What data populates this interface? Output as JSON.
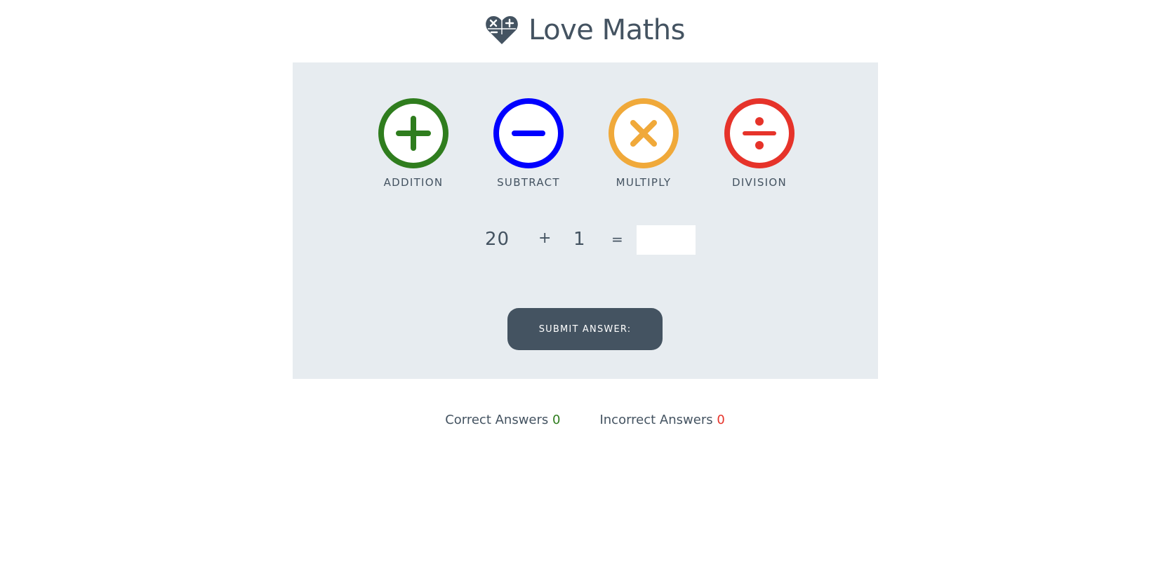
{
  "header": {
    "title": "Love Maths",
    "logo_icon": "heart-calculator-icon"
  },
  "operations": [
    {
      "label": "ADDITION",
      "icon": "plus-circle-icon",
      "color": "#2f7d1e"
    },
    {
      "label": "SUBTRACT",
      "icon": "minus-circle-icon",
      "color": "#0000ff"
    },
    {
      "label": "MULTIPLY",
      "icon": "times-circle-icon",
      "color": "#f0a93a"
    },
    {
      "label": "DIVISION",
      "icon": "divide-circle-icon",
      "color": "#e6332a"
    }
  ],
  "question": {
    "operand1": "20",
    "operator": "+",
    "operand2": "1",
    "equals": "=",
    "answer_value": ""
  },
  "submit": {
    "label": "SUBMIT ANSWER:"
  },
  "score": {
    "correct_label": "Correct Answers",
    "correct_value": "0",
    "incorrect_label": "Incorrect Answers",
    "incorrect_value": "0"
  },
  "colors": {
    "primary": "#445361",
    "panel_bg": "#e7ecf0",
    "correct": "#2f7d1e",
    "incorrect": "#e6332a"
  }
}
